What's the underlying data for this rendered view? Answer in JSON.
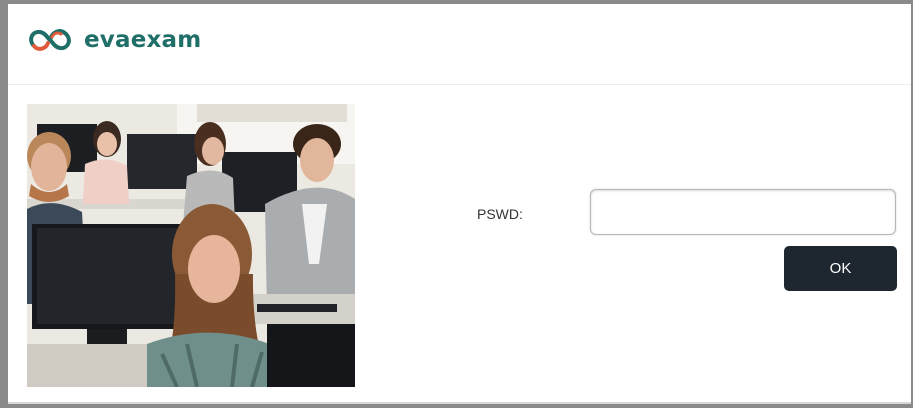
{
  "header": {
    "brand_name": "evaexam",
    "logo_icon": "evaexam-logo-icon",
    "brand_color": "#1f6f68",
    "accent_color": "#e05a3c"
  },
  "login": {
    "password_label": "PSWD:",
    "password_value": "",
    "password_placeholder": "",
    "ok_label": "OK",
    "ok_color": "#1e272f"
  },
  "photo": {
    "icon": "classroom-photo"
  }
}
